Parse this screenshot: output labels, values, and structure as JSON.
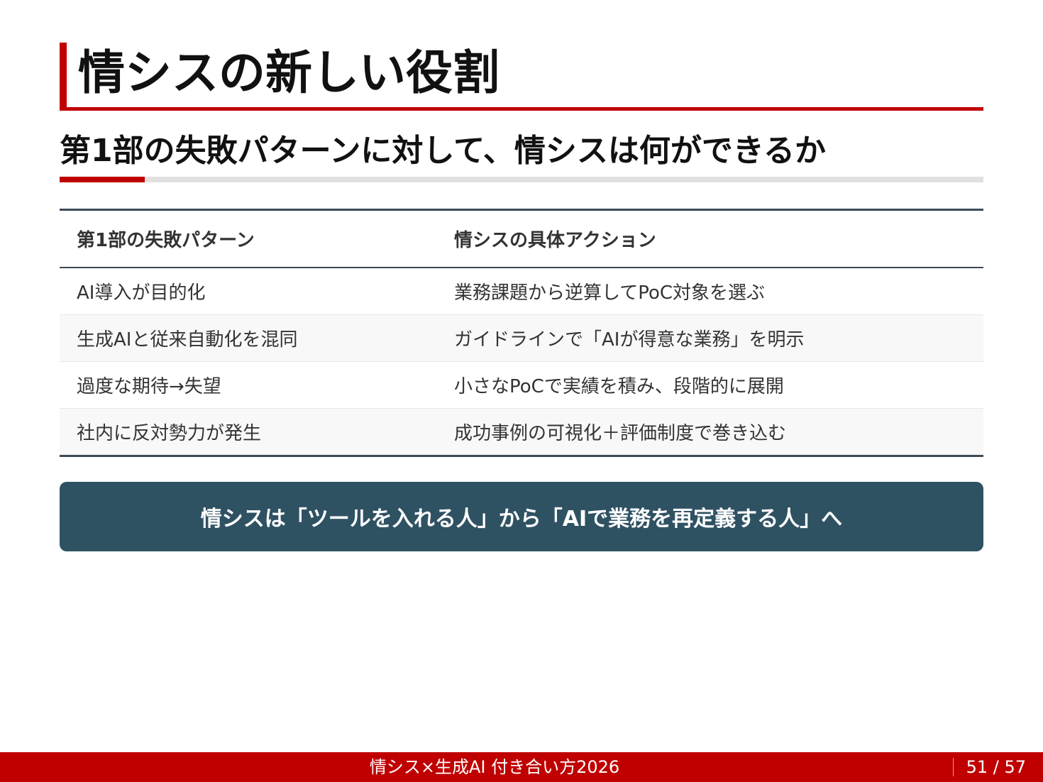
{
  "slide": {
    "title": "情シスの新しい役割",
    "subtitle": "第1部の失敗パターンに対して、情シスは何ができるか"
  },
  "table": {
    "headers": [
      "第1部の失敗パターン",
      "情シスの具体アクション"
    ],
    "rows": [
      [
        "AI導入が目的化",
        "業務課題から逆算してPoC対象を選ぶ"
      ],
      [
        "生成AIと従来自動化を混同",
        "ガイドラインで「AIが得意な業務」を明示"
      ],
      [
        "過度な期待→失望",
        "小さなPoCで実績を積み、段階的に展開"
      ],
      [
        "社内に反対勢力が発生",
        "成功事例の可視化＋評価制度で巻き込む"
      ]
    ]
  },
  "callout": {
    "text": "情シスは「ツールを入れる人」から「AIで業務を再定義する人」へ"
  },
  "footer": {
    "title": "情シス×生成AI 付き合い方2026",
    "page": "51 / 57"
  },
  "colors": {
    "accent_red": "#c00000",
    "callout_bg": "#2f5263",
    "table_rule": "#3d4a56"
  }
}
